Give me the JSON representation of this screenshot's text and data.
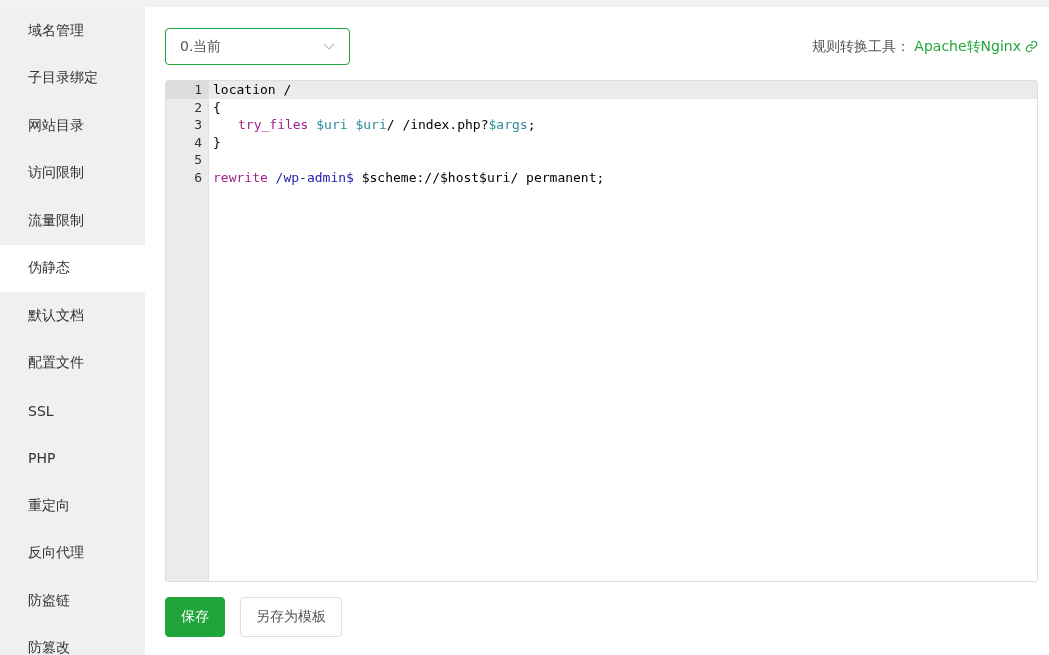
{
  "sidebar": {
    "items": [
      {
        "label": "域名管理",
        "selected": false
      },
      {
        "label": "子目录绑定",
        "selected": false
      },
      {
        "label": "网站目录",
        "selected": false
      },
      {
        "label": "访问限制",
        "selected": false
      },
      {
        "label": "流量限制",
        "selected": false
      },
      {
        "label": "伪静态",
        "selected": true
      },
      {
        "label": "默认文档",
        "selected": false
      },
      {
        "label": "配置文件",
        "selected": false
      },
      {
        "label": "SSL",
        "selected": false
      },
      {
        "label": "PHP",
        "selected": false
      },
      {
        "label": "重定向",
        "selected": false
      },
      {
        "label": "反向代理",
        "selected": false
      },
      {
        "label": "防盗链",
        "selected": false
      },
      {
        "label": "防篡改",
        "selected": false
      }
    ]
  },
  "template_select": {
    "value": "0.当前"
  },
  "converter": {
    "label": "规则转换工具：",
    "link": "Apache转Nginx"
  },
  "editor": {
    "lines": [
      {
        "number": "1",
        "active": true,
        "tokens": [
          {
            "kind": "plain",
            "text": "location /"
          }
        ]
      },
      {
        "number": "2",
        "active": false,
        "tokens": [
          {
            "kind": "plain",
            "text": "{"
          }
        ]
      },
      {
        "number": "3",
        "active": false,
        "indented": true,
        "tokens": [
          {
            "kind": "keyword",
            "text": "try_files"
          },
          {
            "kind": "variable",
            "text": " $uri"
          },
          {
            "kind": "variable",
            "text": " $uri"
          },
          {
            "kind": "plain",
            "text": "/ /index.php?"
          },
          {
            "kind": "variable",
            "text": "$args"
          },
          {
            "kind": "plain",
            "text": ";"
          }
        ]
      },
      {
        "number": "4",
        "active": false,
        "tokens": [
          {
            "kind": "plain",
            "text": "}"
          }
        ]
      },
      {
        "number": "5",
        "active": false
      },
      {
        "number": "6",
        "active": false,
        "tokens": [
          {
            "kind": "keyword",
            "text": "rewrite"
          },
          {
            "kind": "path",
            "text": " /wp-admin$"
          },
          {
            "kind": "plain",
            "text": " $scheme://$host$uri/ permanent;"
          }
        ]
      }
    ]
  },
  "buttons": [
    {
      "label": "保存",
      "kind": "primary"
    },
    {
      "label": "另存为模板",
      "kind": "default"
    }
  ]
}
